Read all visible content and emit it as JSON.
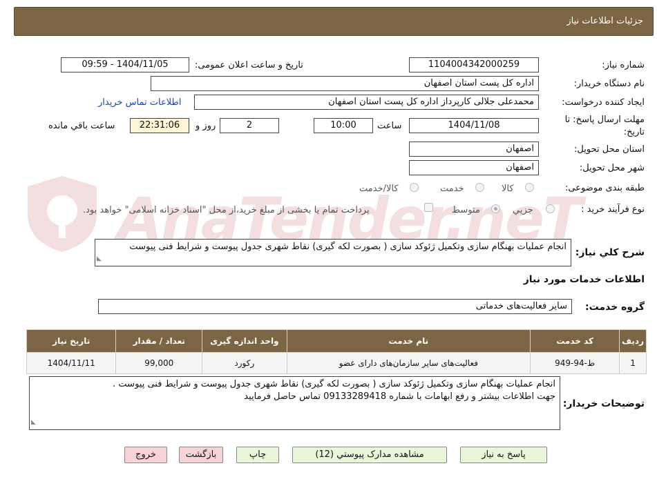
{
  "header": {
    "title": "جزئیات اطلاعات نیاز"
  },
  "watermark": {
    "text": "AnaTender.neT"
  },
  "form": {
    "need_number_label": "شماره نیاز:",
    "need_number": "1104004342000259",
    "announce_label": "تاریخ و ساعت اعلان عمومی:",
    "announce_value": "1404/11/05 - 09:59",
    "buyer_org_label": "نام دستگاه خریدار:",
    "buyer_org": "اداره کل پست استان اصفهان",
    "creator_label": "ایجاد کننده درخواست:",
    "creator": "محمدعلی جلالی کارپرداز اداره کل پست استان اصفهان",
    "contact_link": "اطلاعات تماس خریدار",
    "deadline_label_1": "مهلت ارسال پاسخ: تا",
    "deadline_label_2": "تاریخ:",
    "deadline_date": "1404/11/08",
    "time_label": "ساعت",
    "deadline_time": "10:00",
    "days": "2",
    "days_label": "روز و",
    "remaining_time": "22:31:06",
    "remaining_label": "ساعت باقي مانده",
    "province_label": "استان محل تحویل:",
    "province": "اصفهان",
    "city_label": "شهر محل تحویل:",
    "city": "اصفهان",
    "category_label": "طبقه بندی موضوعی:",
    "category_options": [
      "کالا",
      "خدمت",
      "کالا/خدمت"
    ],
    "process_label": "نوع فرآیند خرید :",
    "process_options": [
      "جزيي",
      "متوسط"
    ],
    "payment_note": "پرداخت تمام یا بخشی از مبلغ خرید،از محل \"اسناد خزانه اسلامی\" خواهد بود.",
    "summary_label": "شرح کلي نياز:",
    "summary": "انجام عملیات بهنگام سازی وتکمیل ژئوکد سازی ( بصورت لکه گیری) نقاط شهری جدول پیوست و شرایط فنی پیوست",
    "services_heading": "اطلاعات خدمات مورد نیاز",
    "service_group_label": "گروه خدمت:",
    "service_group": "سایر فعالیت‌های خدماتی"
  },
  "table": {
    "headers": [
      "ردیف",
      "کد خدمت",
      "نام خدمت",
      "واحد اندازه گیری",
      "تعداد / مقدار",
      "تاریخ نیاز"
    ],
    "rows": [
      [
        "1",
        "ط-94-949",
        "فعالیت‌های سایر سازمان‌های دارای عضو",
        "رکورد",
        "99,000",
        "1404/11/11"
      ]
    ]
  },
  "buyer_notes": {
    "label": "توضیحات خریدار:",
    "line1": "انجام عملیات بهنگام سازی وتکمیل ژئوکد سازی ( بصورت لکه گیری) نقاط شهری جدول پیوست و شرایط فنی پیوست .",
    "line2": "جهت اطلاعات بیشتر و رفع ابهامات با شماره 09133289418 تماس حاصل فرمایید"
  },
  "buttons": {
    "reply": "پاسخ به نیاز",
    "documents": "مشاهده مدارک پیوستي (12)",
    "print": "چاپ",
    "back": "بازگشت",
    "exit": "خروج"
  }
}
